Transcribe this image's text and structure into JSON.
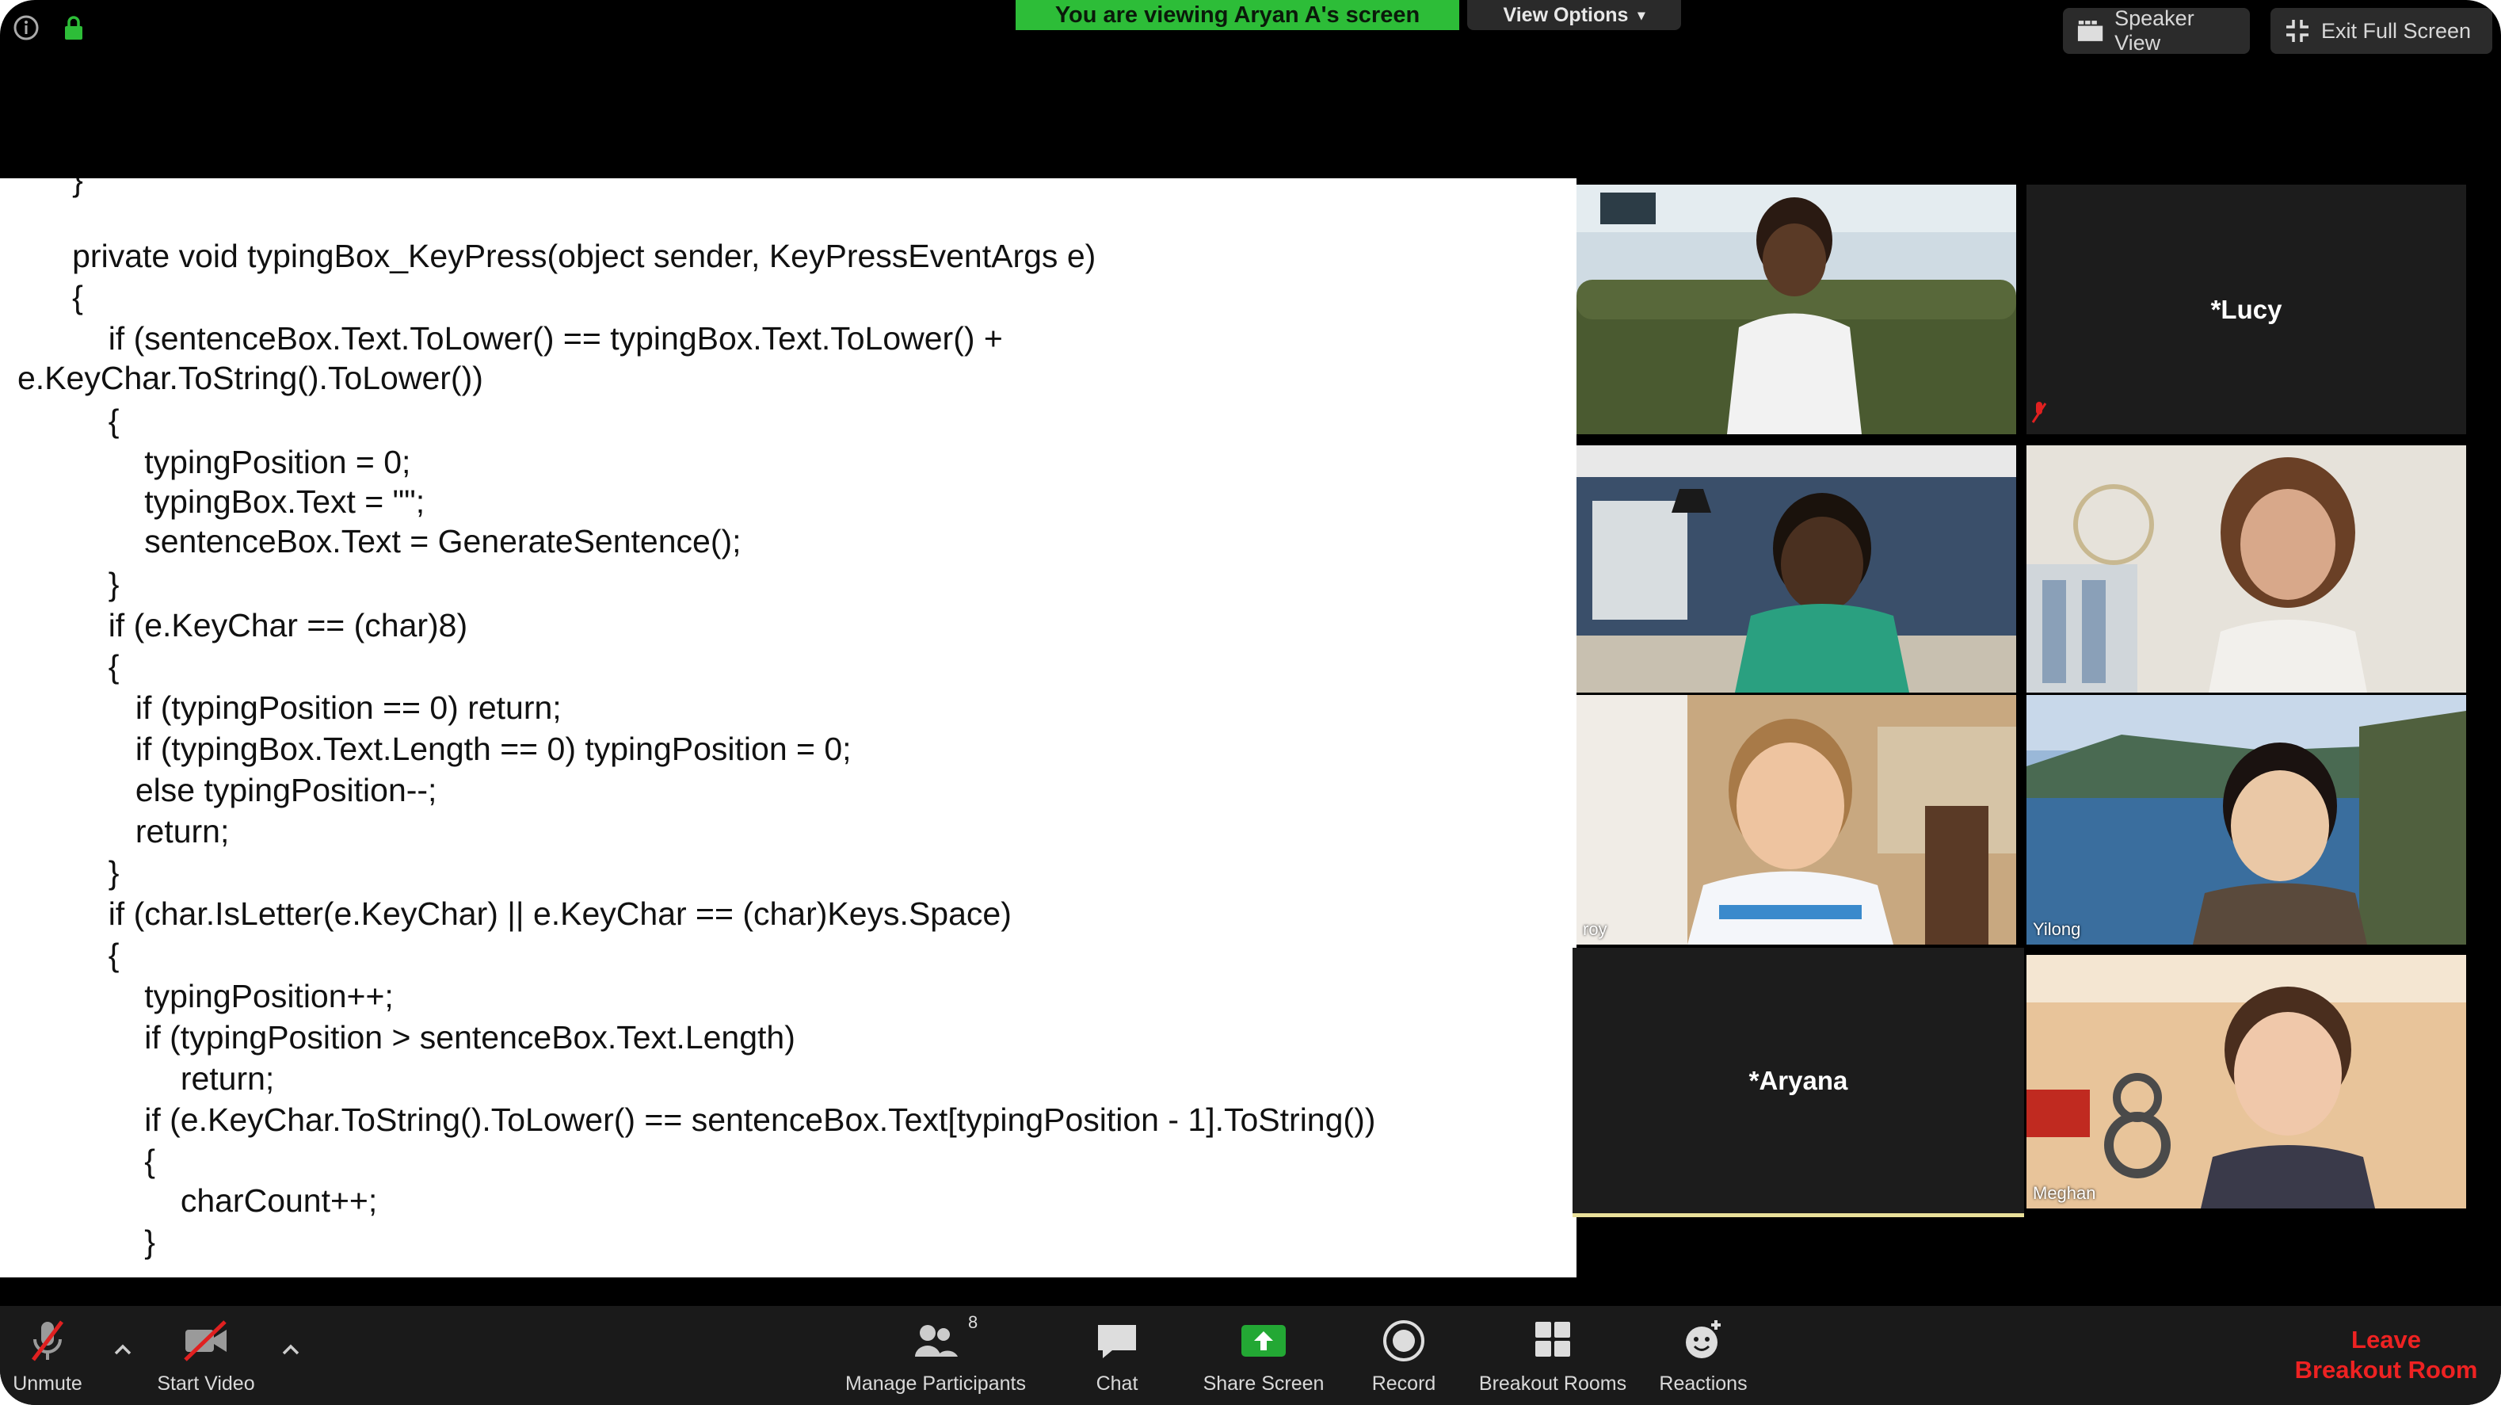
{
  "banner": {
    "viewing_text": "You are viewing Aryan A's screen",
    "view_options": "View Options"
  },
  "top_right": {
    "speaker_view": "Speaker View",
    "exit_full_screen": "Exit Full Screen"
  },
  "code_lines": [
    "        }",
    "        private void typingBox_KeyPress(object sender, KeyPressEventArgs e)",
    "        {",
    "            if (sentenceBox.Text.ToLower() == typingBox.Text.ToLower() +",
    "e.KeyChar.ToString().ToLower())",
    "            {",
    "                typingPosition = 0;",
    "                typingBox.Text = \"\";",
    "                sentenceBox.Text = GenerateSentence();",
    "            }",
    "            if (e.KeyChar == (char)8)",
    "            {",
    "               if (typingPosition == 0) return;",
    "               if (typingBox.Text.Length == 0) typingPosition = 0;",
    "               else typingPosition--;",
    "               return;",
    "            }",
    "            if (char.IsLetter(e.KeyChar) || e.KeyChar == (char)Keys.Space)",
    "            {",
    "                typingPosition++;",
    "                if (typingPosition > sentenceBox.Text.Length)",
    "                    return;",
    "                if (e.KeyChar.ToString().ToLower() == sentenceBox.Text[typingPosition - 1].ToString())",
    "                {",
    "                    charCount++;",
    "                }"
  ],
  "participants": {
    "lucy": "*Lucy",
    "aryana": "*Aryana",
    "roy": "roy",
    "yilong": "Yilong",
    "meghan": "Meghan"
  },
  "toolbar": {
    "unmute": "Unmute",
    "start_video": "Start Video",
    "manage_participants": "Manage Participants",
    "participant_count": "8",
    "chat": "Chat",
    "share_screen": "Share Screen",
    "record": "Record",
    "breakout_rooms": "Breakout Rooms",
    "reactions": "Reactions",
    "leave_line1": "Leave",
    "leave_line2": "Breakout Room"
  },
  "colors": {
    "banner_green": "#2dbd38",
    "share_green": "#23a834",
    "leave_red": "#e22222",
    "muted_red": "#e02020"
  }
}
